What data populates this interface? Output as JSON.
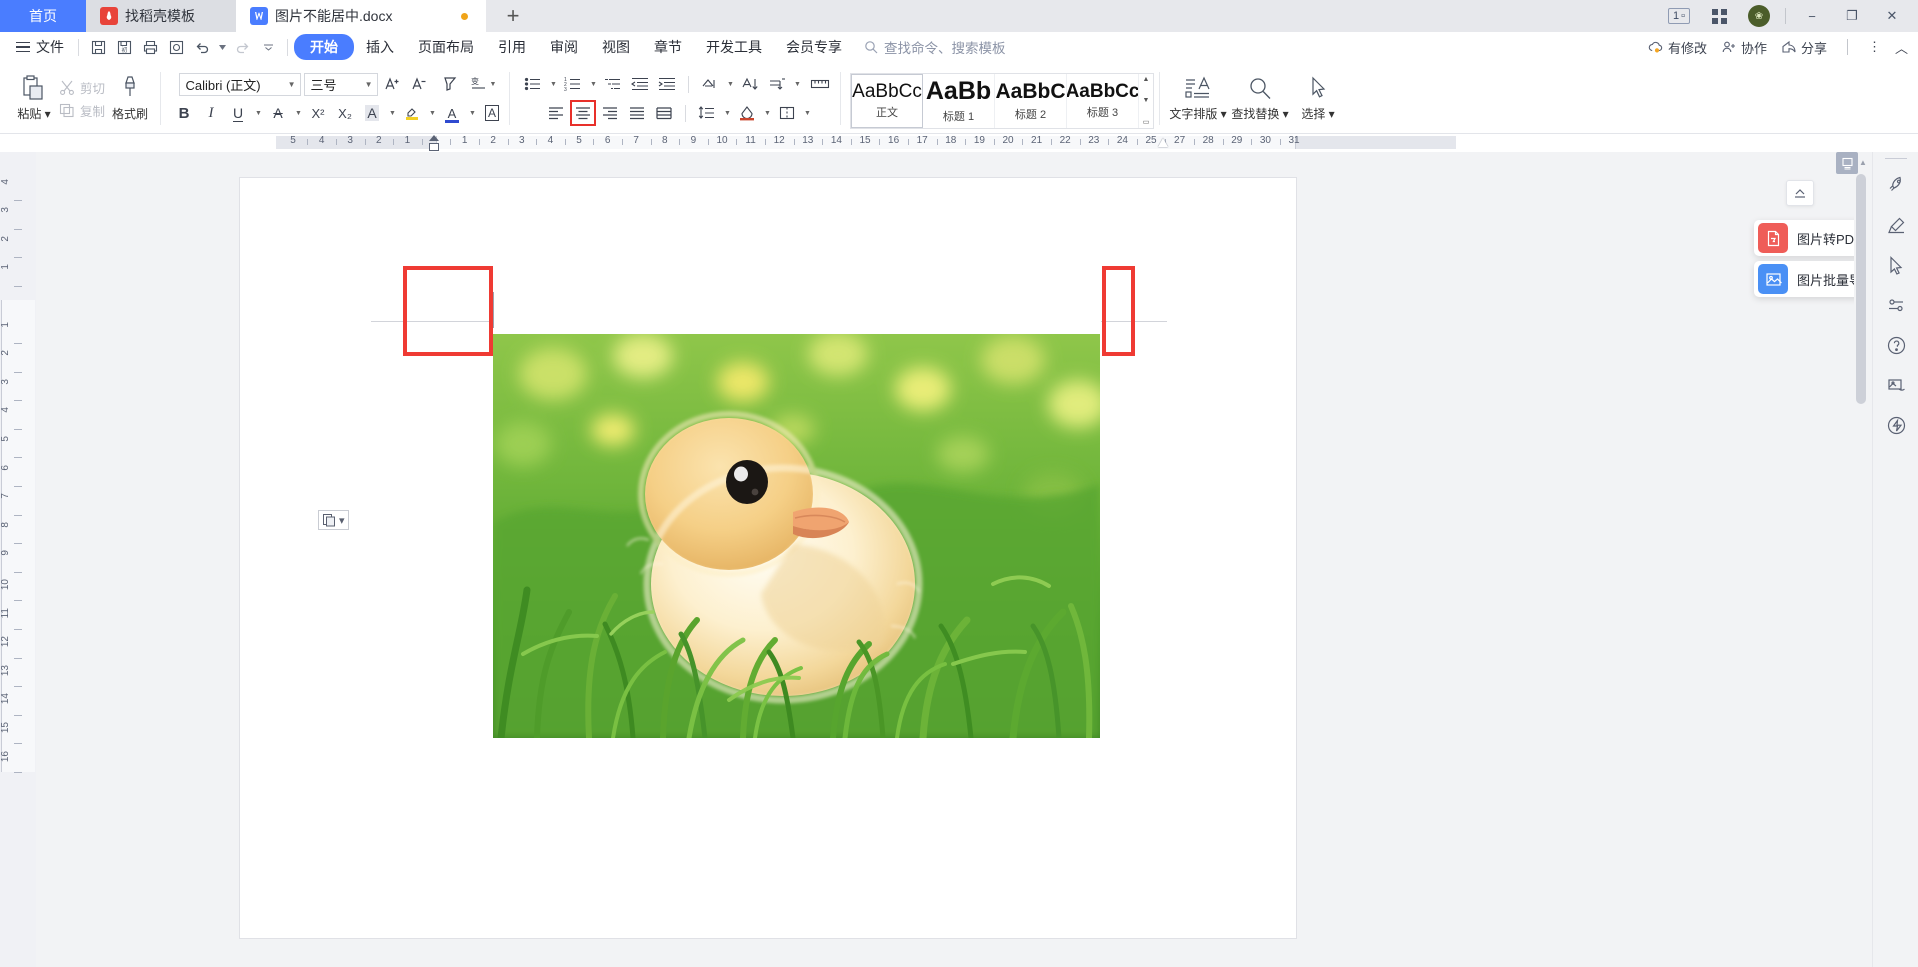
{
  "titlebar": {
    "home_tab": "首页",
    "tabs": [
      {
        "label": "找稻壳模板",
        "icon": "flame-icon",
        "active": false
      },
      {
        "label": "图片不能居中.docx",
        "icon": "wps-writer-icon",
        "active": true,
        "modified": true
      }
    ],
    "new_tab_label": "+",
    "page_indicator": "1",
    "minimize": "−",
    "maximize": "❐",
    "close": "✕"
  },
  "menubar": {
    "file_label": "文件",
    "quick_icons": [
      "save-icon",
      "save-as-icon",
      "print-icon",
      "print-preview-icon",
      "undo-icon",
      "redo-icon",
      "customize-icon"
    ],
    "tabs": [
      {
        "label": "开始",
        "active": true
      },
      {
        "label": "插入",
        "active": false
      },
      {
        "label": "页面布局",
        "active": false
      },
      {
        "label": "引用",
        "active": false
      },
      {
        "label": "审阅",
        "active": false
      },
      {
        "label": "视图",
        "active": false
      },
      {
        "label": "章节",
        "active": false
      },
      {
        "label": "开发工具",
        "active": false
      },
      {
        "label": "会员专享",
        "active": false
      }
    ],
    "search_placeholder": "查找命令、搜索模板",
    "right_items": [
      {
        "label": "有修改",
        "icon": "cloud-sync-icon"
      },
      {
        "label": "协作",
        "icon": "collaborate-icon"
      },
      {
        "label": "分享",
        "icon": "share-icon"
      }
    ],
    "more_label": "⋮",
    "collapse_label": "︿"
  },
  "ribbon": {
    "clipboard": {
      "paste_label": "粘贴",
      "cut_label": "剪切",
      "copy_label": "复制",
      "format_painter_label": "格式刷"
    },
    "font": {
      "family": "Calibri (正文)",
      "size": "三号",
      "grow_label": "A⁺",
      "shrink_label": "A⁻",
      "clear_format_label": "clear-format-icon",
      "pinyin_label": "拼音指南",
      "bold": "B",
      "italic": "I",
      "underline": "U",
      "strikethrough": "A",
      "superscript": "X²",
      "subscript": "X₂",
      "char_shade": "A",
      "highlight": "highlight-icon",
      "font_color": "A",
      "char_border": "A"
    },
    "paragraph": {
      "bullets": "bullet-list-icon",
      "numbering": "numbered-list-icon",
      "outline": "multilevel-list-icon",
      "decrease_indent": "decrease-indent-icon",
      "increase_indent": "increase-indent-icon",
      "sort": "sort-icon",
      "show_marks": "show-marks-icon",
      "align_left": "align-left-icon",
      "align_center": "align-center-icon",
      "align_right": "align-right-icon",
      "justify": "justify-icon",
      "distribute": "distribute-icon",
      "line_spacing": "line-spacing-icon",
      "shading": "shading-icon",
      "borders": "borders-icon",
      "selected_button": "align-center-icon"
    },
    "styles": [
      {
        "preview": "AaBbCc",
        "name": "正文",
        "selected": true,
        "bold": false,
        "size": 19
      },
      {
        "preview": "AaBb",
        "name": "标题 1",
        "selected": false,
        "bold": true,
        "size": 25
      },
      {
        "preview": "AaBbC",
        "name": "标题 2",
        "selected": false,
        "bold": true,
        "size": 21
      },
      {
        "preview": "AaBbCc",
        "name": "标题 3",
        "selected": false,
        "bold": true,
        "size": 19
      }
    ],
    "tools": [
      {
        "label": "文字排版",
        "icon": "text-layout-icon",
        "caret": true
      },
      {
        "label": "查找替换",
        "icon": "search-replace-icon",
        "caret": true
      },
      {
        "label": "选择",
        "icon": "select-cursor-icon",
        "caret": true
      }
    ]
  },
  "ruler": {
    "h_numbers_left": [
      "5",
      "4",
      "3",
      "2",
      "1"
    ],
    "h_numbers_right": [
      "1",
      "2",
      "3",
      "4",
      "5",
      "6",
      "7",
      "8",
      "9",
      "10",
      "11",
      "12",
      "13",
      "14",
      "15",
      "16",
      "17",
      "18",
      "19",
      "20",
      "21",
      "22",
      "23",
      "24",
      "25",
      "27",
      "28",
      "29",
      "30",
      "31"
    ],
    "v_numbers_above": [
      "4",
      "3",
      "2",
      "1"
    ],
    "v_numbers_below": [
      "1",
      "2",
      "3",
      "4",
      "5",
      "6",
      "7",
      "8",
      "9",
      "10",
      "11",
      "12",
      "13",
      "14",
      "15",
      "16"
    ]
  },
  "document": {
    "paste_options_label": "paste-options-icon",
    "image_alt": "yellow chick standing in green grass",
    "annotations": [
      {
        "name": "left-margin-highlight",
        "color": "#ef3a33"
      },
      {
        "name": "right-margin-highlight",
        "color": "#ef3a33"
      }
    ]
  },
  "float_panel": {
    "collapse_icon": "panel-collapse-icon",
    "cards": [
      {
        "label": "图片转PDF",
        "icon": "pdf-convert-icon",
        "color": "#ef5d58"
      },
      {
        "label": "图片批量导出",
        "icon": "image-export-icon",
        "color": "#4a90f5"
      }
    ]
  },
  "right_sidebar": {
    "icons": [
      {
        "name": "rocket-icon"
      },
      {
        "name": "brush-icon"
      },
      {
        "name": "cursor-icon"
      },
      {
        "name": "sliders-icon"
      },
      {
        "name": "help-icon"
      },
      {
        "name": "image-tools-icon"
      },
      {
        "name": "lightning-icon"
      }
    ]
  },
  "colors": {
    "accent": "#4a7dff",
    "annotation_red": "#ef3a33",
    "titlebar_bg": "#e7e8ec",
    "workspace_bg": "#f2f3f5"
  }
}
